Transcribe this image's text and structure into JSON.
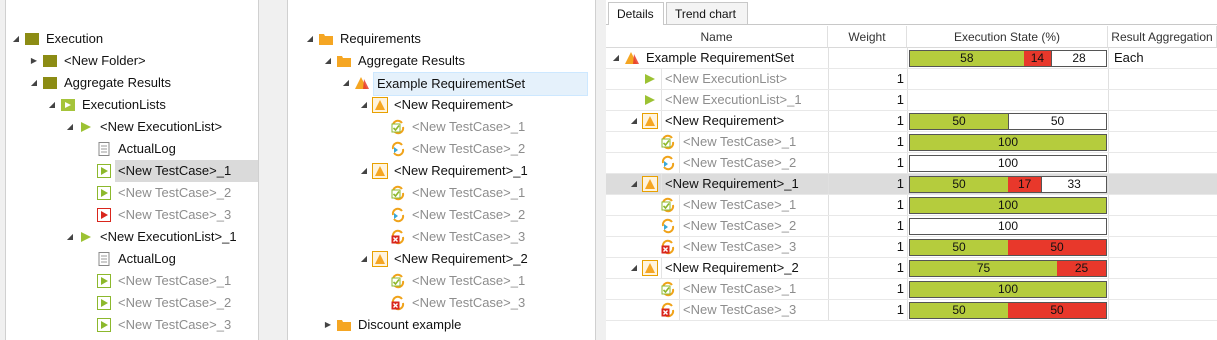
{
  "left_tree": {
    "rows": [
      {
        "label": "Execution",
        "depth": 0,
        "expand": "open",
        "icon": "folder-olive",
        "muted": false
      },
      {
        "label": "<New Folder>",
        "depth": 1,
        "expand": "closed",
        "icon": "folder-olive",
        "muted": false
      },
      {
        "label": "Aggregate Results",
        "depth": 1,
        "expand": "open",
        "icon": "folder-olive",
        "muted": false
      },
      {
        "label": "ExecutionLists",
        "depth": 2,
        "expand": "open",
        "icon": "execution-lists-folder",
        "muted": false
      },
      {
        "label": "<New ExecutionList>",
        "depth": 3,
        "expand": "open",
        "icon": "execution-list",
        "muted": false
      },
      {
        "label": "ActualLog",
        "depth": 4,
        "expand": "none",
        "icon": "log",
        "muted": false
      },
      {
        "label": "<New TestCase>_1",
        "depth": 4,
        "expand": "none",
        "icon": "testcase-passed",
        "muted": false,
        "selected": true
      },
      {
        "label": "<New TestCase>_2",
        "depth": 4,
        "expand": "none",
        "icon": "testcase-passed",
        "muted": true
      },
      {
        "label": "<New TestCase>_3",
        "depth": 4,
        "expand": "none",
        "icon": "testcase-failed",
        "muted": true
      },
      {
        "label": "<New ExecutionList>_1",
        "depth": 3,
        "expand": "open",
        "icon": "execution-list",
        "muted": false
      },
      {
        "label": "ActualLog",
        "depth": 4,
        "expand": "none",
        "icon": "log",
        "muted": false
      },
      {
        "label": "<New TestCase>_1",
        "depth": 4,
        "expand": "none",
        "icon": "testcase-passed",
        "muted": true
      },
      {
        "label": "<New TestCase>_2",
        "depth": 4,
        "expand": "none",
        "icon": "testcase-passed",
        "muted": true
      },
      {
        "label": "<New TestCase>_3",
        "depth": 4,
        "expand": "none",
        "icon": "testcase-passed",
        "muted": true
      }
    ]
  },
  "middle_tree": {
    "rows": [
      {
        "label": "Requirements",
        "depth": 0,
        "expand": "open",
        "icon": "folder-orange",
        "muted": false
      },
      {
        "label": "Aggregate Results",
        "depth": 1,
        "expand": "open",
        "icon": "folder-orange",
        "muted": false
      },
      {
        "label": "Example RequirementSet",
        "depth": 2,
        "expand": "open",
        "icon": "requirementset",
        "muted": false,
        "selected": true
      },
      {
        "label": "<New Requirement>",
        "depth": 3,
        "expand": "open",
        "icon": "requirement",
        "muted": false
      },
      {
        "label": "<New TestCase>_1",
        "depth": 4,
        "expand": "none",
        "icon": "tc-link-passed",
        "muted": true
      },
      {
        "label": "<New TestCase>_2",
        "depth": 4,
        "expand": "none",
        "icon": "tc-link-notexecuted",
        "muted": true
      },
      {
        "label": "<New Requirement>_1",
        "depth": 3,
        "expand": "open",
        "icon": "requirement",
        "muted": false
      },
      {
        "label": "<New TestCase>_1",
        "depth": 4,
        "expand": "none",
        "icon": "tc-link-passed",
        "muted": true
      },
      {
        "label": "<New TestCase>_2",
        "depth": 4,
        "expand": "none",
        "icon": "tc-link-notexecuted",
        "muted": true
      },
      {
        "label": "<New TestCase>_3",
        "depth": 4,
        "expand": "none",
        "icon": "tc-link-failed",
        "muted": true
      },
      {
        "label": "<New Requirement>_2",
        "depth": 3,
        "expand": "open",
        "icon": "requirement",
        "muted": false
      },
      {
        "label": "<New TestCase>_1",
        "depth": 4,
        "expand": "none",
        "icon": "tc-link-passed",
        "muted": true
      },
      {
        "label": "<New TestCase>_3",
        "depth": 4,
        "expand": "none",
        "icon": "tc-link-failed",
        "muted": true
      },
      {
        "label": "Discount example",
        "depth": 1,
        "expand": "closed",
        "icon": "folder-orange",
        "muted": false
      }
    ]
  },
  "details": {
    "tabs": [
      {
        "label": "Details",
        "active": true
      },
      {
        "label": "Trend chart",
        "active": false
      }
    ],
    "headers": {
      "name": "Name",
      "weight": "Weight",
      "state": "Execution State (%)",
      "agg": "Result Aggregation"
    },
    "rows": [
      {
        "name": "Example RequirementSet",
        "depth": 0,
        "expand": "open",
        "icon": "requirementset",
        "muted": false,
        "weight": "",
        "state": [
          {
            "k": "green",
            "v": 58,
            "t": "58"
          },
          {
            "k": "red",
            "v": 14,
            "t": "14"
          },
          {
            "k": "white",
            "v": 28,
            "t": "28"
          }
        ],
        "agg": "Each",
        "hl": false
      },
      {
        "name": "<New ExecutionList>",
        "depth": 1,
        "expand": "none",
        "icon": "execution-list",
        "muted": true,
        "weight": "1",
        "state": [],
        "agg": "",
        "hl": false
      },
      {
        "name": "<New ExecutionList>_1",
        "depth": 1,
        "expand": "none",
        "icon": "execution-list",
        "muted": true,
        "weight": "1",
        "state": [],
        "agg": "",
        "hl": false
      },
      {
        "name": "<New Requirement>",
        "depth": 1,
        "expand": "open",
        "icon": "requirement",
        "muted": false,
        "weight": "1",
        "state": [
          {
            "k": "green",
            "v": 50,
            "t": "50"
          },
          {
            "k": "white",
            "v": 50,
            "t": "50"
          }
        ],
        "agg": "",
        "hl": false
      },
      {
        "name": "<New TestCase>_1",
        "depth": 2,
        "expand": "none",
        "icon": "tc-link-passed",
        "muted": true,
        "weight": "1",
        "state": [
          {
            "k": "green",
            "v": 100,
            "t": "100"
          }
        ],
        "agg": "",
        "hl": false
      },
      {
        "name": "<New TestCase>_2",
        "depth": 2,
        "expand": "none",
        "icon": "tc-link-notexecuted",
        "muted": true,
        "weight": "1",
        "state": [
          {
            "k": "white",
            "v": 100,
            "t": "100"
          }
        ],
        "agg": "",
        "hl": false
      },
      {
        "name": "<New Requirement>_1",
        "depth": 1,
        "expand": "open",
        "icon": "requirement",
        "muted": false,
        "weight": "1",
        "state": [
          {
            "k": "green",
            "v": 50,
            "t": "50"
          },
          {
            "k": "red",
            "v": 17,
            "t": "17"
          },
          {
            "k": "white",
            "v": 33,
            "t": "33"
          }
        ],
        "agg": "",
        "hl": true
      },
      {
        "name": "<New TestCase>_1",
        "depth": 2,
        "expand": "none",
        "icon": "tc-link-passed",
        "muted": true,
        "weight": "1",
        "state": [
          {
            "k": "green",
            "v": 100,
            "t": "100"
          }
        ],
        "agg": "",
        "hl": false
      },
      {
        "name": "<New TestCase>_2",
        "depth": 2,
        "expand": "none",
        "icon": "tc-link-notexecuted",
        "muted": true,
        "weight": "1",
        "state": [
          {
            "k": "white",
            "v": 100,
            "t": "100"
          }
        ],
        "agg": "",
        "hl": false
      },
      {
        "name": "<New TestCase>_3",
        "depth": 2,
        "expand": "none",
        "icon": "tc-link-failed",
        "muted": true,
        "weight": "1",
        "state": [
          {
            "k": "green",
            "v": 50,
            "t": "50"
          },
          {
            "k": "red",
            "v": 50,
            "t": "50"
          }
        ],
        "agg": "",
        "hl": false
      },
      {
        "name": "<New Requirement>_2",
        "depth": 1,
        "expand": "open",
        "icon": "requirement",
        "muted": false,
        "weight": "1",
        "state": [
          {
            "k": "green",
            "v": 75,
            "t": "75"
          },
          {
            "k": "red",
            "v": 25,
            "t": "25"
          }
        ],
        "agg": "",
        "hl": false
      },
      {
        "name": "<New TestCase>_1",
        "depth": 2,
        "expand": "none",
        "icon": "tc-link-passed",
        "muted": true,
        "weight": "1",
        "state": [
          {
            "k": "green",
            "v": 100,
            "t": "100"
          }
        ],
        "agg": "",
        "hl": false
      },
      {
        "name": "<New TestCase>_3",
        "depth": 2,
        "expand": "none",
        "icon": "tc-link-failed",
        "muted": true,
        "weight": "1",
        "state": [
          {
            "k": "green",
            "v": 50,
            "t": "50"
          },
          {
            "k": "red",
            "v": 50,
            "t": "50"
          }
        ],
        "agg": "",
        "hl": false
      }
    ]
  },
  "colors": {
    "passed": "#b5cc3d",
    "failed": "#e8382b",
    "not_executed": "#ffffff",
    "olive": "#8c8c14",
    "orange": "#f5a623"
  }
}
